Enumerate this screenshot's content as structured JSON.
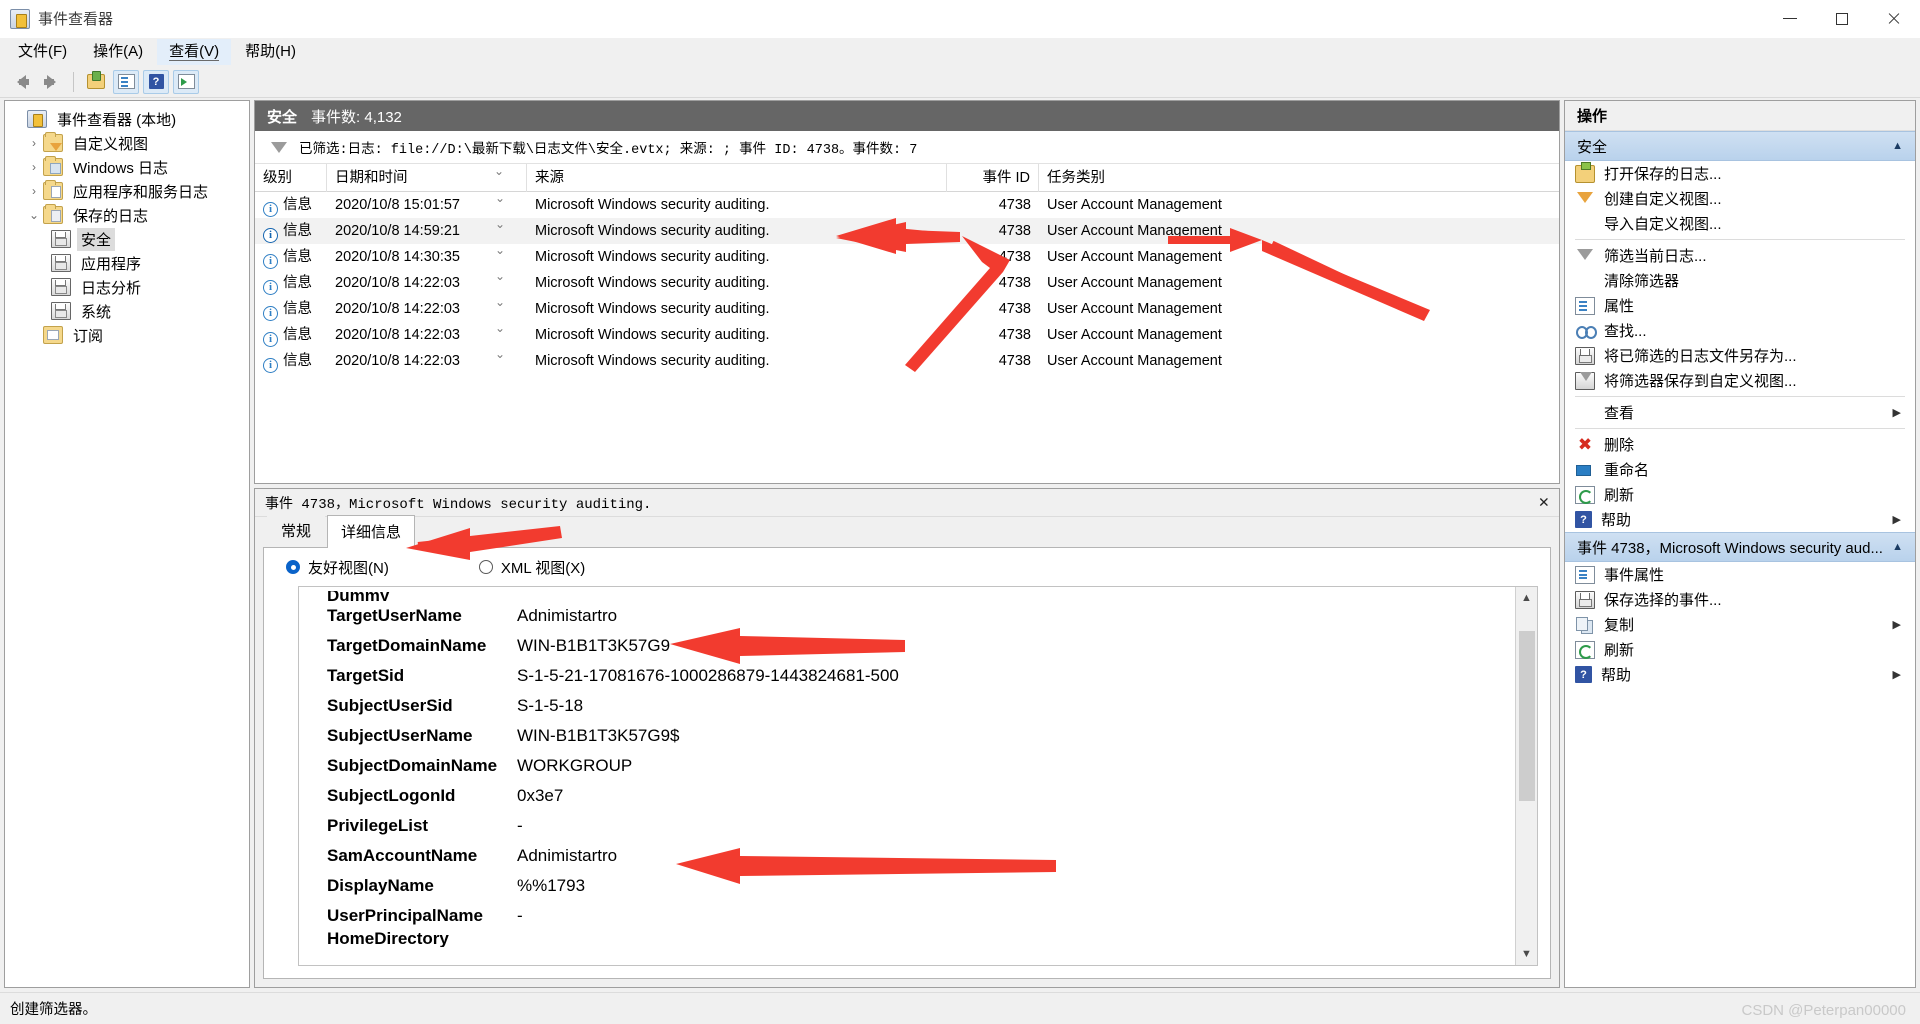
{
  "window": {
    "title": "事件查看器",
    "app_icon": "event-viewer-icon",
    "minimize": "–",
    "maximize": "□",
    "close": "✕"
  },
  "menu": [
    {
      "label": "文件(F)",
      "name": "menu-file"
    },
    {
      "label": "操作(A)",
      "name": "menu-action"
    },
    {
      "label": "查看(V)",
      "name": "menu-view",
      "active": true
    },
    {
      "label": "帮助(H)",
      "name": "menu-help"
    }
  ],
  "toolbar": {
    "back": "back-arrow-icon",
    "forward": "forward-arrow-icon",
    "open_saved_log": "open-saved-log-icon",
    "properties": "properties-icon",
    "help": "?",
    "show_action_pane": "show-action-pane-icon"
  },
  "tree": {
    "root": {
      "label": "事件查看器 (本地)",
      "icon": "event-viewer-icon"
    },
    "items": [
      {
        "label": "自定义视图",
        "icon": "custom-views-folder-icon",
        "twist": "›",
        "level": 1
      },
      {
        "label": "Windows 日志",
        "icon": "windows-logs-folder-icon",
        "twist": "›",
        "level": 1
      },
      {
        "label": "应用程序和服务日志",
        "icon": "app-service-logs-folder-icon",
        "twist": "›",
        "level": 1
      },
      {
        "label": "保存的日志",
        "icon": "saved-logs-folder-icon",
        "twist": "⌄",
        "level": 1
      },
      {
        "label": "安全",
        "icon": "log-file-icon",
        "level": 2,
        "selected": true
      },
      {
        "label": "应用程序",
        "icon": "log-file-icon",
        "level": 2
      },
      {
        "label": "日志分析",
        "icon": "log-file-icon",
        "level": 2
      },
      {
        "label": "系统",
        "icon": "log-file-icon",
        "level": 2
      },
      {
        "label": "订阅",
        "icon": "subscriptions-folder-icon",
        "level": 1
      }
    ]
  },
  "list": {
    "header_name": "安全",
    "header_count": "事件数: 4,132",
    "filter_icon": "filter-funnel-icon",
    "filter_text": "已筛选:日志: file://D:\\最新下载\\日志文件\\安全.evtx; 来源: ; 事件 ID: 4738。事件数: 7",
    "columns": [
      "级别",
      "日期和时间",
      "来源",
      "事件 ID",
      "任务类别"
    ],
    "rows": [
      {
        "level": "信息",
        "datetime": "2020/10/8 15:01:57",
        "source": "Microsoft Windows security auditing.",
        "event_id": "4738",
        "task": "User Account Management",
        "selected": false
      },
      {
        "level": "信息",
        "datetime": "2020/10/8 14:59:21",
        "source": "Microsoft Windows security auditing.",
        "event_id": "4738",
        "task": "User Account Management",
        "selected": true
      },
      {
        "level": "信息",
        "datetime": "2020/10/8 14:30:35",
        "source": "Microsoft Windows security auditing.",
        "event_id": "4738",
        "task": "User Account Management",
        "selected": false
      },
      {
        "level": "信息",
        "datetime": "2020/10/8 14:22:03",
        "source": "Microsoft Windows security auditing.",
        "event_id": "4738",
        "task": "User Account Management",
        "selected": false
      },
      {
        "level": "信息",
        "datetime": "2020/10/8 14:22:03",
        "source": "Microsoft Windows security auditing.",
        "event_id": "4738",
        "task": "User Account Management",
        "selected": false
      },
      {
        "level": "信息",
        "datetime": "2020/10/8 14:22:03",
        "source": "Microsoft Windows security auditing.",
        "event_id": "4738",
        "task": "User Account Management",
        "selected": false
      },
      {
        "level": "信息",
        "datetime": "2020/10/8 14:22:03",
        "source": "Microsoft Windows security auditing.",
        "event_id": "4738",
        "task": "User Account Management",
        "selected": false
      }
    ]
  },
  "detail": {
    "title": "事件 4738，Microsoft Windows security auditing.",
    "close": "✕",
    "tabs": [
      {
        "label": "常规",
        "name": "tab-general",
        "active": false
      },
      {
        "label": "详细信息",
        "name": "tab-details",
        "active": true
      }
    ],
    "view_modes": [
      {
        "label": "友好视图(N)",
        "name": "radio-friendly-view",
        "selected": true
      },
      {
        "label": "XML 视图(X)",
        "name": "radio-xml-view",
        "selected": false
      }
    ],
    "partial_top": "Dummy",
    "partial_bottom": "HomeDirectory",
    "fields": [
      {
        "key": "TargetUserName",
        "value": "Adnimistartro"
      },
      {
        "key": "TargetDomainName",
        "value": "WIN-B1B1T3K57G9"
      },
      {
        "key": "TargetSid",
        "value": "S-1-5-21-17081676-1000286879-1443824681-500"
      },
      {
        "key": "SubjectUserSid",
        "value": "S-1-5-18"
      },
      {
        "key": "SubjectUserName",
        "value": "WIN-B1B1T3K57G9$"
      },
      {
        "key": "SubjectDomainName",
        "value": "WORKGROUP"
      },
      {
        "key": "SubjectLogonId",
        "value": "0x3e7"
      },
      {
        "key": "PrivilegeList",
        "value": "-"
      },
      {
        "key": "SamAccountName",
        "value": "Adnimistartro"
      },
      {
        "key": "DisplayName",
        "value": "%%1793"
      },
      {
        "key": "UserPrincipalName",
        "value": "-"
      }
    ],
    "scroll_up": "▲",
    "scroll_down": "▼"
  },
  "actions": {
    "title": "操作",
    "groups": [
      {
        "label": "安全",
        "caret": "▲",
        "name": "action-group-security",
        "items": [
          {
            "label": "打开保存的日志...",
            "icon": "open-saved-log-icon",
            "name": "action-open-saved-log"
          },
          {
            "label": "创建自定义视图...",
            "icon": "create-custom-view-icon",
            "name": "action-create-custom-view"
          },
          {
            "label": "导入自定义视图...",
            "icon": "blank-icon",
            "name": "action-import-custom-view"
          },
          {
            "separator": true
          },
          {
            "label": "筛选当前日志...",
            "icon": "filter-funnel-icon",
            "name": "action-filter-current-log"
          },
          {
            "label": "清除筛选器",
            "icon": "blank-icon",
            "name": "action-clear-filter"
          },
          {
            "label": "属性",
            "icon": "properties-icon",
            "name": "action-properties"
          },
          {
            "label": "查找...",
            "icon": "find-binoculars-icon",
            "name": "action-find"
          },
          {
            "label": "将已筛选的日志文件另存为...",
            "icon": "save-icon",
            "name": "action-save-filtered-log"
          },
          {
            "label": "将筛选器保存到自定义视图...",
            "icon": "save-filter-icon",
            "name": "action-save-filter-to-custom-view"
          },
          {
            "separator": true
          },
          {
            "label": "查看",
            "icon": "blank-icon",
            "submenu": "▶",
            "name": "action-view"
          },
          {
            "separator": true
          },
          {
            "label": "删除",
            "icon": "delete-x-icon",
            "name": "action-delete"
          },
          {
            "label": "重命名",
            "icon": "rename-icon",
            "name": "action-rename"
          },
          {
            "label": "刷新",
            "icon": "refresh-icon",
            "name": "action-refresh"
          },
          {
            "label": "帮助",
            "icon": "help-icon",
            "submenu": "▶",
            "name": "action-help"
          }
        ]
      },
      {
        "label": "事件 4738，Microsoft Windows security aud...",
        "caret": "▲",
        "name": "action-group-event",
        "items": [
          {
            "label": "事件属性",
            "icon": "event-properties-icon",
            "name": "action-event-properties"
          },
          {
            "label": "保存选择的事件...",
            "icon": "save-icon",
            "name": "action-save-selected-events"
          },
          {
            "label": "复制",
            "icon": "copy-icon",
            "submenu": "▶",
            "name": "action-copy"
          },
          {
            "label": "刷新",
            "icon": "refresh-icon",
            "name": "action-refresh-event"
          },
          {
            "label": "帮助",
            "icon": "help-icon",
            "submenu": "▶",
            "name": "action-help-event"
          }
        ]
      }
    ]
  },
  "status": {
    "text": "创建筛选器。"
  },
  "watermark": {
    "text": "CSDN @Peterpan00000"
  }
}
